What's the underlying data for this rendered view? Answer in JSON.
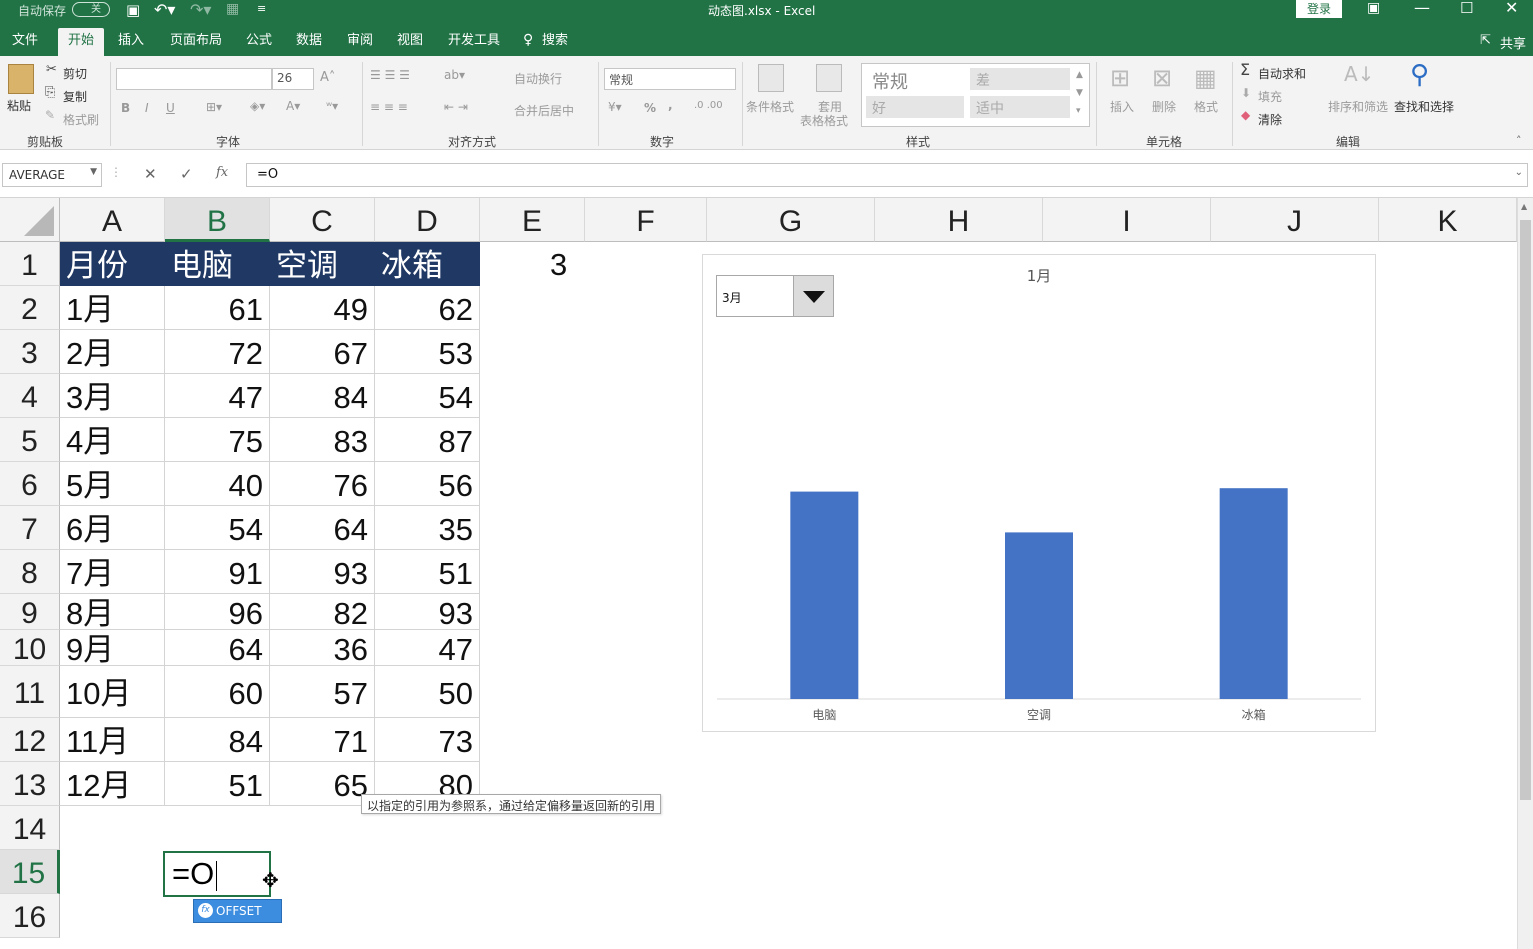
{
  "titlebar": {
    "autosave_label": "自动保存",
    "autosave_state": "关",
    "title": "动态图.xlsx - Excel",
    "login": "登录"
  },
  "tabs": [
    "文件",
    "开始",
    "插入",
    "页面布局",
    "公式",
    "数据",
    "审阅",
    "视图",
    "开发工具",
    "搜索"
  ],
  "share": "共享",
  "ribbon": {
    "clipboard": {
      "paste": "粘贴",
      "cut": "剪切",
      "copy": "复制",
      "format_painter": "格式刷",
      "label": "剪贴板"
    },
    "font": {
      "size": "26",
      "bold": "B",
      "italic": "I",
      "underline": "U",
      "label": "字体"
    },
    "alignment": {
      "wrap": "自动换行",
      "merge": "合并后居中",
      "label": "对齐方式"
    },
    "number": {
      "format": "常规",
      "percent": "%",
      "comma": ",",
      "label": "数字"
    },
    "styles": {
      "cond_format": "条件格式",
      "table_format_1": "套用",
      "table_format_2": "表格格式",
      "normal": "常规",
      "bad": "差",
      "good": "好",
      "neutral": "适中",
      "label": "样式"
    },
    "cells": {
      "insert": "插入",
      "delete": "删除",
      "format": "格式",
      "label": "单元格"
    },
    "editing": {
      "autosum": "自动求和",
      "fill": "填充",
      "clear": "清除",
      "sort_filter": "排序和筛选",
      "find_select": "查找和选择",
      "label": "编辑"
    }
  },
  "formula_bar": {
    "name_box": "AVERAGE",
    "formula": "=O"
  },
  "columns": [
    "A",
    "B",
    "C",
    "D",
    "E",
    "F",
    "G",
    "H",
    "I",
    "J",
    "K"
  ],
  "rows": [
    "1",
    "2",
    "3",
    "4",
    "5",
    "6",
    "7",
    "8",
    "9",
    "10",
    "11",
    "12",
    "13",
    "14",
    "15",
    "16"
  ],
  "table": {
    "header": [
      "月份",
      "电脑",
      "空调",
      "冰箱"
    ],
    "data": [
      [
        "1月",
        "61",
        "49",
        "62"
      ],
      [
        "2月",
        "72",
        "67",
        "53"
      ],
      [
        "3月",
        "47",
        "84",
        "54"
      ],
      [
        "4月",
        "75",
        "83",
        "87"
      ],
      [
        "5月",
        "40",
        "76",
        "56"
      ],
      [
        "6月",
        "54",
        "64",
        "35"
      ],
      [
        "7月",
        "91",
        "93",
        "51"
      ],
      [
        "8月",
        "96",
        "82",
        "93"
      ],
      [
        "9月",
        "64",
        "36",
        "47"
      ],
      [
        "10月",
        "60",
        "57",
        "50"
      ],
      [
        "11月",
        "84",
        "71",
        "73"
      ],
      [
        "12月",
        "51",
        "65",
        "80"
      ]
    ]
  },
  "e1_value": "3",
  "dropdown_value": "3月",
  "chart_data": {
    "type": "bar",
    "title": "1月",
    "categories": [
      "电脑",
      "空调",
      "冰箱"
    ],
    "values": [
      61,
      49,
      62
    ],
    "ylim": [
      0,
      100
    ],
    "bar_color": "#4472C4",
    "grid": false,
    "legend": "none"
  },
  "tooltip": "以指定的引用为参照系，通过给定偏移量返回新的引用",
  "edit_cell": "=O",
  "autocomplete": "OFFSET",
  "colors": {
    "excel_green": "#217346",
    "header_fill": "#203864",
    "bar": "#4472C4",
    "autocomplete_bg": "#3c8ce0"
  }
}
